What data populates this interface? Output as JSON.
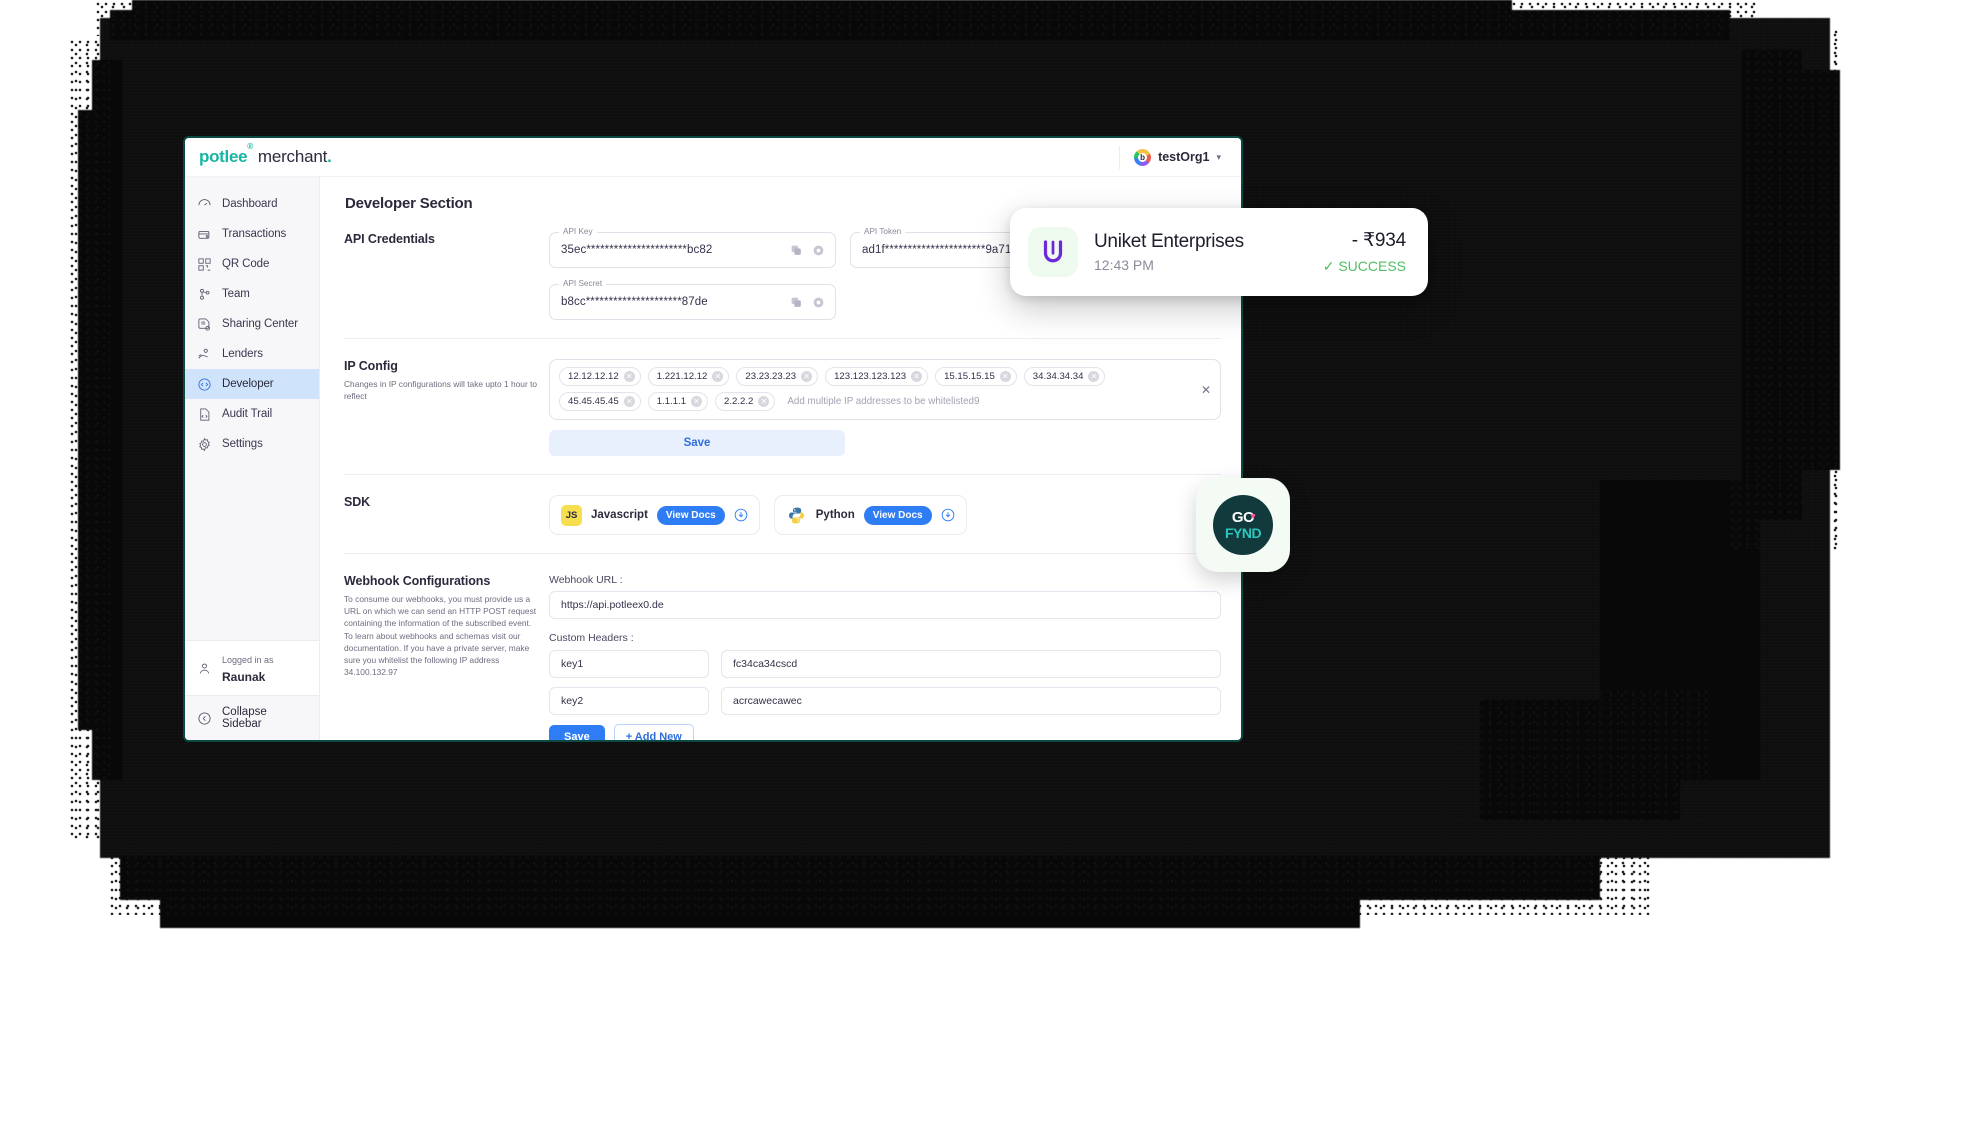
{
  "brand": {
    "name": "potlee",
    "reg": "®",
    "product": "merchant",
    "dot": "."
  },
  "topbar": {
    "org_name": "testOrg1",
    "chevron": "chevron-down",
    "avatar_mark": "b"
  },
  "sidebar": {
    "items": [
      {
        "label": "Dashboard",
        "icon": "dashboard-icon",
        "active": false
      },
      {
        "label": "Transactions",
        "icon": "transactions-icon",
        "active": false
      },
      {
        "label": "QR Code",
        "icon": "qr-code-icon",
        "active": false
      },
      {
        "label": "Team",
        "icon": "team-icon",
        "active": false
      },
      {
        "label": "Sharing Center",
        "icon": "sharing-center-icon",
        "active": false
      },
      {
        "label": "Lenders",
        "icon": "lenders-icon",
        "active": false
      },
      {
        "label": "Developer",
        "icon": "developer-icon",
        "active": true
      },
      {
        "label": "Audit Trail",
        "icon": "audit-trail-icon",
        "active": false
      },
      {
        "label": "Settings",
        "icon": "settings-icon",
        "active": false
      }
    ],
    "logged_in_label": "Logged in as",
    "user_name": "Raunak",
    "collapse_label": "Collapse Sidebar"
  },
  "page": {
    "title": "Developer Section"
  },
  "api_credentials": {
    "section_title": "API Credentials",
    "fields": [
      {
        "legend": "API Key",
        "value": "35ec**********************bc82"
      },
      {
        "legend": "API Token",
        "value": "ad1f**********************9a71"
      },
      {
        "legend": "API Secret",
        "value": "b8cc*********************87de"
      }
    ],
    "copy_icon": "copy-icon",
    "eye_icon": "eye-icon"
  },
  "ip_config": {
    "section_title": "IP Config",
    "section_sub": "Changes in IP configurations will take upto 1 hour to reflect",
    "chips": [
      "12.12.12.12",
      "1.221.12.12",
      "23.23.23.23",
      "123.123.123.123",
      "15.15.15.15",
      "34.34.34.34",
      "45.45.45.45",
      "1.1.1.1",
      "2.2.2.2"
    ],
    "placeholder": "Add multiple IP addresses to be whitelisted9",
    "clear_all_icon": "close-icon",
    "save_label": "Save"
  },
  "sdk": {
    "section_title": "SDK",
    "cards": [
      {
        "name": "Javascript",
        "badge": "JS",
        "docs_label": "View Docs",
        "download_icon": "download-icon"
      },
      {
        "name": "Python",
        "badge": "PY",
        "docs_label": "View Docs",
        "download_icon": "download-icon"
      }
    ]
  },
  "webhook": {
    "section_title": "Webhook Configurations",
    "section_sub": "To consume our webhooks, you must provide us a URL on which we can send an HTTP POST request containing the information of the subscribed event. To learn about webhooks and schemas visit our documentation. If you have a private server, make sure you whitelist the following IP address 34.100.132.97",
    "url_label": "Webhook URL :",
    "url_value": "https://api.potleex0.de",
    "headers_label": "Custom Headers :",
    "headers": [
      {
        "key": "key1",
        "value": "fc34ca34cscd"
      },
      {
        "key": "key2",
        "value": "acrcawecawec"
      }
    ],
    "save_label": "Save",
    "add_new_label": "+ Add New"
  },
  "toast": {
    "merchant": "Uniket Enterprises",
    "time": "12:43 PM",
    "amount": "- ₹934",
    "status": "SUCCESS",
    "status_check": "✓",
    "logo": "uniket-u-logo"
  },
  "fynd_badge": {
    "go": "GO",
    "fynd": "FYND",
    "heart": "♥"
  },
  "colors": {
    "brand_teal": "#18b5a4",
    "accent_blue": "#2f7df4",
    "active_nav": "#cfe4fb",
    "success_green": "#4fbf63",
    "window_border": "#0b4a42",
    "js_yellow": "#f5de4f"
  }
}
